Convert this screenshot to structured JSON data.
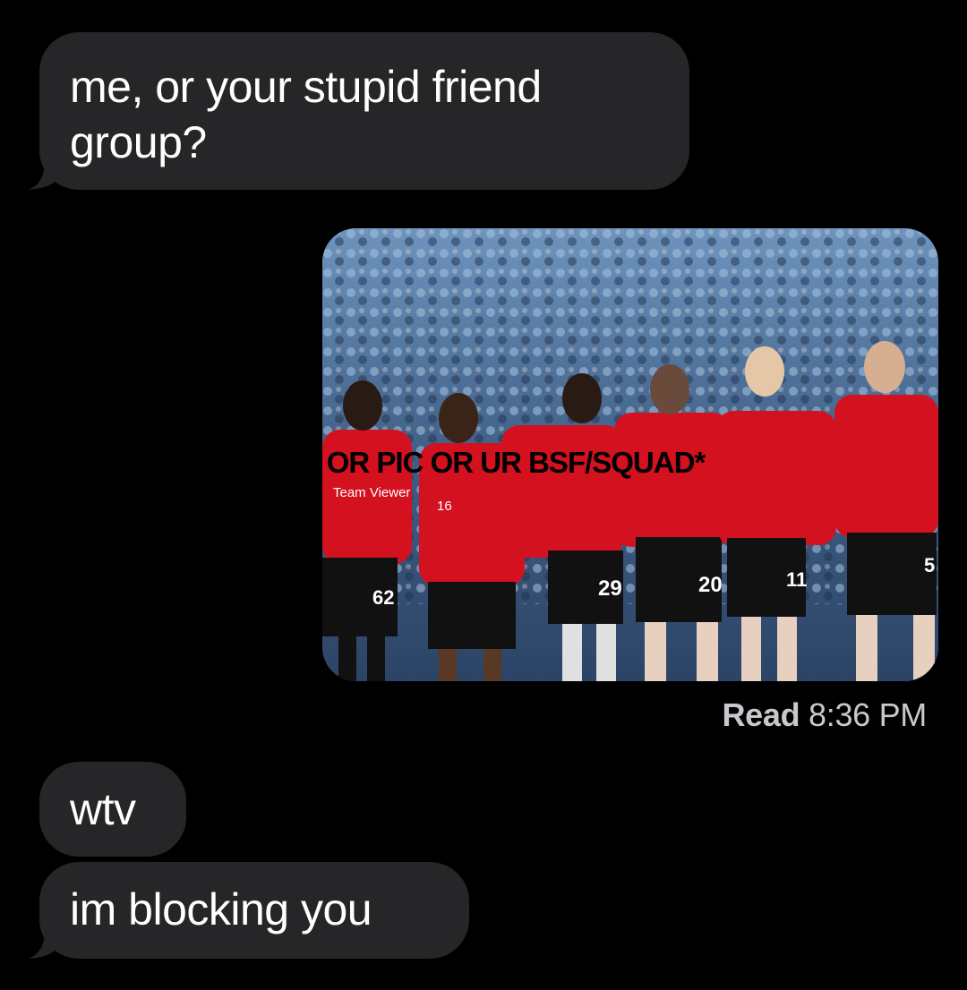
{
  "messages": [
    {
      "direction": "received",
      "text": "me, or your stupid friend group?"
    },
    {
      "direction": "sent",
      "type": "image",
      "image_description": "photo of football team"
    },
    {
      "direction": "received",
      "text": "wtv"
    },
    {
      "direction": "received",
      "text": "im blocking you"
    }
  ],
  "overlay_caption": "*VID OR PIC OR UR BSF/SQUAD*",
  "read_receipt": {
    "label": "Read",
    "time": "8:36 PM"
  },
  "photo": {
    "sponsor_text": "Team Viewer",
    "shirt_numbers": [
      "62",
      "16",
      "29",
      "20",
      "11",
      "5"
    ]
  },
  "colors": {
    "background": "#000000",
    "bubble_received": "#262629",
    "text": "#ffffff",
    "receipt": "#c7c7cc",
    "kit_red": "#d4111e",
    "shorts": "#111111"
  }
}
